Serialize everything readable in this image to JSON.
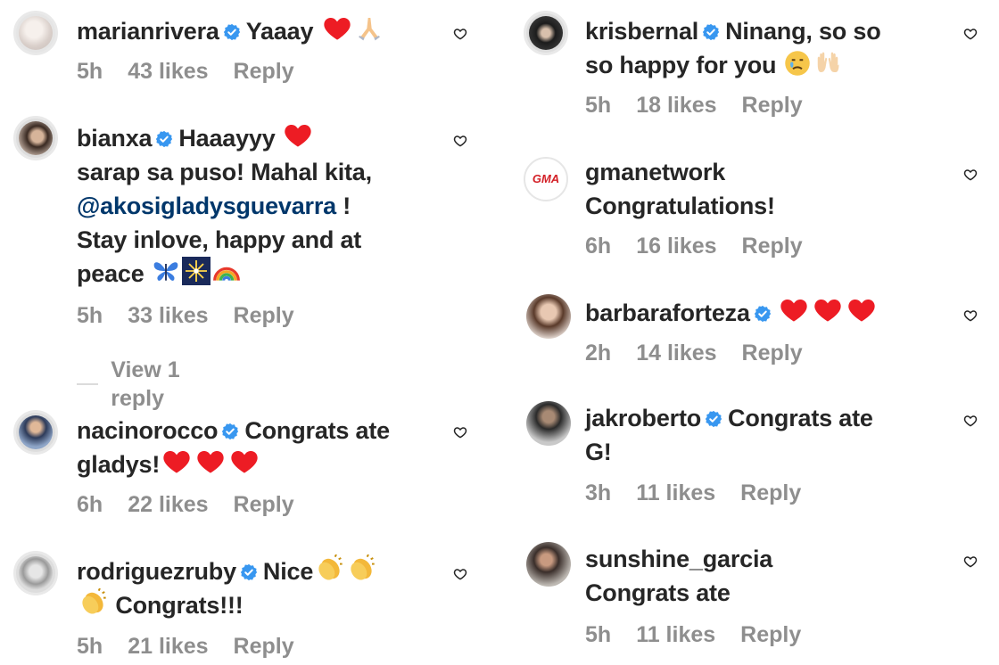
{
  "comments": [
    {
      "username": "marianrivera",
      "verified": true,
      "text": "Yaaay",
      "time": "5h",
      "likes": "43 likes",
      "reply": "Reply"
    },
    {
      "username": "bianxa",
      "verified": true,
      "text_l1": "Haaayyy",
      "text_l2": "sarap sa puso! Mahal kita,",
      "mention": "@akosigladysguevarra",
      "mention_tail": " !",
      "text_l4": "Stay inlove, happy and at",
      "text_l5": "peace",
      "time": "5h",
      "likes": "33 likes",
      "reply": "Reply",
      "view_replies": "View 1 reply"
    },
    {
      "username": "nacinorocco",
      "verified": true,
      "text_l1": "Congrats ate",
      "text_l2": "gladys!",
      "time": "6h",
      "likes": "22 likes",
      "reply": "Reply"
    },
    {
      "username": "rodriguezruby",
      "verified": true,
      "text_l1": "Nice",
      "text_l2": "Congrats!!!",
      "time": "5h",
      "likes": "21 likes",
      "reply": "Reply"
    },
    {
      "username": "krisbernal",
      "verified": true,
      "text_l1": "Ninang, so so",
      "text_l2": "so happy for you",
      "time": "5h",
      "likes": "18 likes",
      "reply": "Reply"
    },
    {
      "username": "gmanetwork",
      "verified": false,
      "text_l1": "Congratulations!",
      "avatar_text": "GMA",
      "time": "6h",
      "likes": "16 likes",
      "reply": "Reply"
    },
    {
      "username": "barbaraforteza",
      "verified": true,
      "time": "2h",
      "likes": "14 likes",
      "reply": "Reply"
    },
    {
      "username": "jakroberto",
      "verified": true,
      "text_l1": "Congrats ate",
      "text_l2": "G!",
      "time": "3h",
      "likes": "11 likes",
      "reply": "Reply"
    },
    {
      "username": "sunshine_garcia",
      "verified": false,
      "text_l1": "Congrats ate",
      "time": "5h",
      "likes": "11 likes",
      "reply": "Reply"
    }
  ],
  "colors": {
    "verified": "#3897f0",
    "muted": "#8e8e8e",
    "mention": "#00376b",
    "heart": "#ed1c24"
  },
  "icons": {
    "verified": "verified-badge-icon",
    "like": "heart-outline-icon",
    "heart": "red-heart-emoji"
  }
}
